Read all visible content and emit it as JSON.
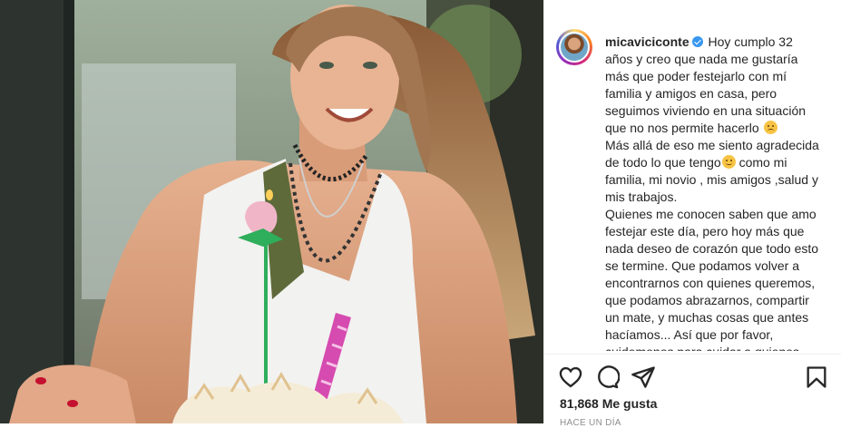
{
  "post": {
    "username": "micaviciconte",
    "verified": true,
    "caption_paragraphs": [
      "Hoy cumplo 32 años y creo que nada me gustaría más que poder festejarlo con mí familia y amigos en casa, pero seguimos viviendo en una situación que no nos permite hacerlo",
      "Más allá de eso me siento agradecida de todo lo que tengo",
      "como mi familia, mi novio , mis amigos ,salud y mis trabajos.",
      "Quienes me conocen saben que amo festejar este día, pero hoy más que nada deseo de corazón que todo esto se termine. Que podamos volver a encontrarnos con quienes queremos, que podamos abrazarnos, compartir un mate, y muchas cosas que antes hacíamos... Así que por favor, cuidemonos para cuidar a quienes más queremos."
    ],
    "emojis": {
      "disappointed": "disappointed-face",
      "smile": "smiling-face"
    },
    "likes": "81,868 Me gusta",
    "timestamp": "Hace un día"
  },
  "icons": {
    "like": "heart-icon",
    "comment": "comment-icon",
    "share": "share-icon",
    "save": "bookmark-icon"
  },
  "colors": {
    "text": "#262626",
    "secondary": "#8e8e8e",
    "verified": "#3897f0",
    "divider": "#efefef"
  }
}
